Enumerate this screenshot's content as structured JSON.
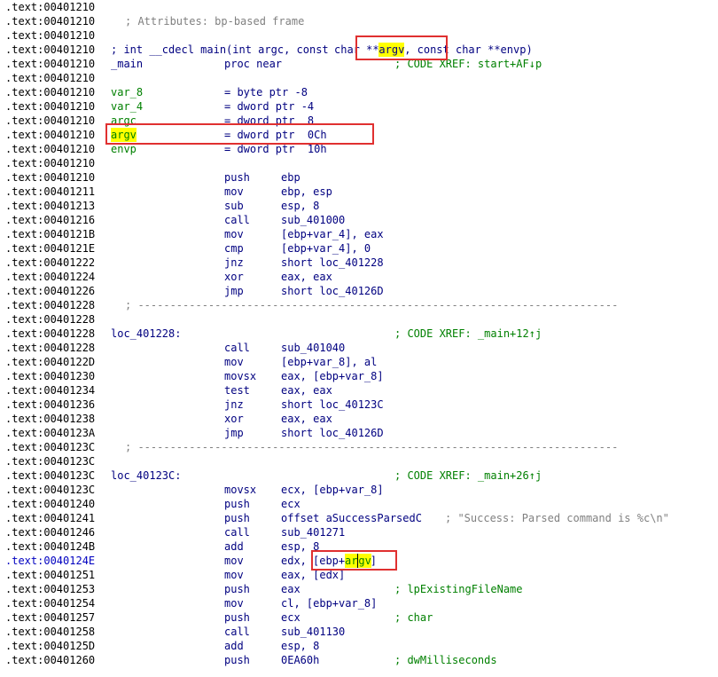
{
  "colors": {
    "address": "#000000",
    "address_current": "#0000c0",
    "code": "#000080",
    "comment": "#808080",
    "xref": "#008000",
    "highlight": "#ffff00",
    "box": "#e03030"
  },
  "lines": [
    {
      "addr": ".text:00401210"
    },
    {
      "addr": ".text:00401210",
      "comment": "; Attributes: bp-based frame"
    },
    {
      "addr": ".text:00401210"
    },
    {
      "addr": ".text:00401210",
      "proto_a": "; int __cdecl main(int argc, const ",
      "proto_b": "char **",
      "proto_hl": "argv",
      "proto_c": ", const char **envp)"
    },
    {
      "addr": ".text:00401210",
      "label": "_main",
      "mnem": "proc near",
      "xref": "; CODE XREF: start+AF↓p"
    },
    {
      "addr": ".text:00401210"
    },
    {
      "addr": ".text:00401210",
      "label": "var_8",
      "mnem": "= byte ptr -8"
    },
    {
      "addr": ".text:00401210",
      "label": "var_4",
      "mnem": "= dword ptr -4"
    },
    {
      "addr": ".text:00401210",
      "label": "argc",
      "mnem": "= dword ptr  8"
    },
    {
      "addr": ".text:00401210",
      "label_hl": "argv",
      "mnem": "= dword ptr  0Ch"
    },
    {
      "addr": ".text:00401210",
      "label": "envp",
      "mnem": "= dword ptr  10h"
    },
    {
      "addr": ".text:00401210"
    },
    {
      "addr": ".text:00401210",
      "mnem": "push",
      "ops": "ebp"
    },
    {
      "addr": ".text:00401211",
      "mnem": "mov",
      "ops": "ebp, esp"
    },
    {
      "addr": ".text:00401213",
      "mnem": "sub",
      "ops": "esp, 8"
    },
    {
      "addr": ".text:00401216",
      "mnem": "call",
      "ops": "sub_401000"
    },
    {
      "addr": ".text:0040121B",
      "mnem": "mov",
      "ops": "[ebp+var_4], eax"
    },
    {
      "addr": ".text:0040121E",
      "mnem": "cmp",
      "ops": "[ebp+var_4], 0"
    },
    {
      "addr": ".text:00401222",
      "mnem": "jnz",
      "ops": "short loc_401228"
    },
    {
      "addr": ".text:00401224",
      "mnem": "xor",
      "ops": "eax, eax"
    },
    {
      "addr": ".text:00401226",
      "mnem": "jmp",
      "ops": "short loc_40126D"
    },
    {
      "addr": ".text:00401228",
      "sep": "; ---------------------------------------------------------------------------"
    },
    {
      "addr": ".text:00401228"
    },
    {
      "addr": ".text:00401228",
      "label": "loc_401228:",
      "xref": "; CODE XREF: _main+12↑j"
    },
    {
      "addr": ".text:00401228",
      "mnem": "call",
      "ops": "sub_401040"
    },
    {
      "addr": ".text:0040122D",
      "mnem": "mov",
      "ops": "[ebp+var_8], al"
    },
    {
      "addr": ".text:00401230",
      "mnem": "movsx",
      "ops": "eax, [ebp+var_8]"
    },
    {
      "addr": ".text:00401234",
      "mnem": "test",
      "ops": "eax, eax"
    },
    {
      "addr": ".text:00401236",
      "mnem": "jnz",
      "ops": "short loc_40123C"
    },
    {
      "addr": ".text:00401238",
      "mnem": "xor",
      "ops": "eax, eax"
    },
    {
      "addr": ".text:0040123A",
      "mnem": "jmp",
      "ops": "short loc_40126D"
    },
    {
      "addr": ".text:0040123C",
      "sep": "; ---------------------------------------------------------------------------"
    },
    {
      "addr": ".text:0040123C"
    },
    {
      "addr": ".text:0040123C",
      "label": "loc_40123C:",
      "xref": "; CODE XREF: _main+26↑j"
    },
    {
      "addr": ".text:0040123C",
      "mnem": "movsx",
      "ops": "ecx, [ebp+var_8]"
    },
    {
      "addr": ".text:00401240",
      "mnem": "push",
      "ops": "ecx"
    },
    {
      "addr": ".text:00401241",
      "mnem": "push",
      "ops": "offset aSuccessParsedC",
      "comment": "; \"Success: Parsed command is %c\\n\""
    },
    {
      "addr": ".text:00401246",
      "mnem": "call",
      "ops": "sub_401271"
    },
    {
      "addr": ".text:0040124B",
      "mnem": "add",
      "ops": "esp, 8"
    },
    {
      "addr": ".text:0040124E",
      "current": true,
      "mnem": "mov",
      "ops_a": "edx, ",
      "ops_b": "[ebp+",
      "ops_hl1": "ar",
      "ops_hl2": "gv",
      "ops_c": "]"
    },
    {
      "addr": ".text:00401251",
      "mnem": "mov",
      "ops": "eax, [edx]"
    },
    {
      "addr": ".text:00401253",
      "mnem": "push",
      "ops": "eax",
      "xref": "; lpExistingFileName"
    },
    {
      "addr": ".text:00401254",
      "mnem": "mov",
      "ops": "cl, [ebp+var_8]"
    },
    {
      "addr": ".text:00401257",
      "mnem": "push",
      "ops": "ecx",
      "xref": "; char"
    },
    {
      "addr": ".text:00401258",
      "mnem": "call",
      "ops": "sub_401130"
    },
    {
      "addr": ".text:0040125D",
      "mnem": "add",
      "ops": "esp, 8"
    },
    {
      "addr": ".text:00401260",
      "mnem": "push",
      "ops": "0EA60h",
      "xref": "; dwMilliseconds"
    }
  ]
}
